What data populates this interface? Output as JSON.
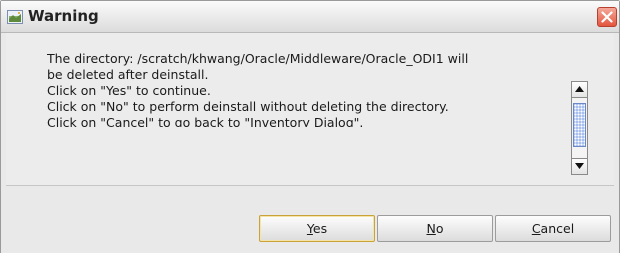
{
  "window": {
    "title": "Warning",
    "icon": "warning-window-icon",
    "close_icon": "close-icon",
    "colors": {
      "close_button": "#e4553e",
      "thumb": "#a9c0ef",
      "default_border": "#c9a23a"
    }
  },
  "message": {
    "lines": [
      "The directory: /scratch/khwang/Oracle/Middleware/Oracle_ODI1 will",
      "be deleted after deinstall.",
      "Click on \"Yes\" to continue.",
      "Click on \"No\" to perform deinstall without deleting the directory.",
      "Click on \"Cancel\" to go back to \"Inventory Dialog\"."
    ]
  },
  "scrollbar": {
    "up_icon": "arrow-up-icon",
    "down_icon": "arrow-down-icon"
  },
  "buttons": {
    "yes": {
      "mnemonic": "Y",
      "rest": "es"
    },
    "no": {
      "mnemonic": "N",
      "rest": "o"
    },
    "cancel": {
      "mnemonic": "C",
      "rest": "ancel"
    }
  }
}
